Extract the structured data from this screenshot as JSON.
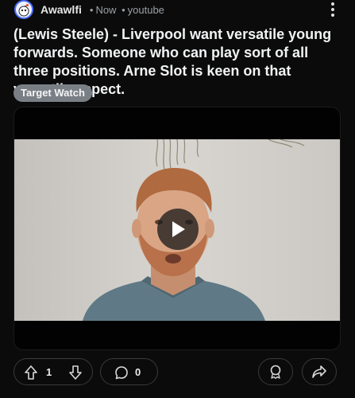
{
  "post": {
    "username": "Awawlfi",
    "time": "Now",
    "source": "youtube",
    "title": "(Lewis Steele) - Liverpool want versatile young forwards. Someone who can play sort of all three positions. Arne Slot is keen on that versatile aspect.",
    "flair": "Target Watch"
  },
  "actions": {
    "upvotes": "1",
    "comments": "0"
  },
  "icons": {
    "avatar": "reddit-snoo-avatar-icon",
    "more": "more-vertical-icon",
    "play": "play-icon",
    "upvote": "arrow-up-icon",
    "downvote": "arrow-down-icon",
    "comment": "comment-bubble-icon",
    "award": "award-icon",
    "share": "share-arrow-icon"
  },
  "colors": {
    "background": "#0b0b0b",
    "flair": "#7a7f85",
    "avatar_ring": "#4c6fff"
  }
}
